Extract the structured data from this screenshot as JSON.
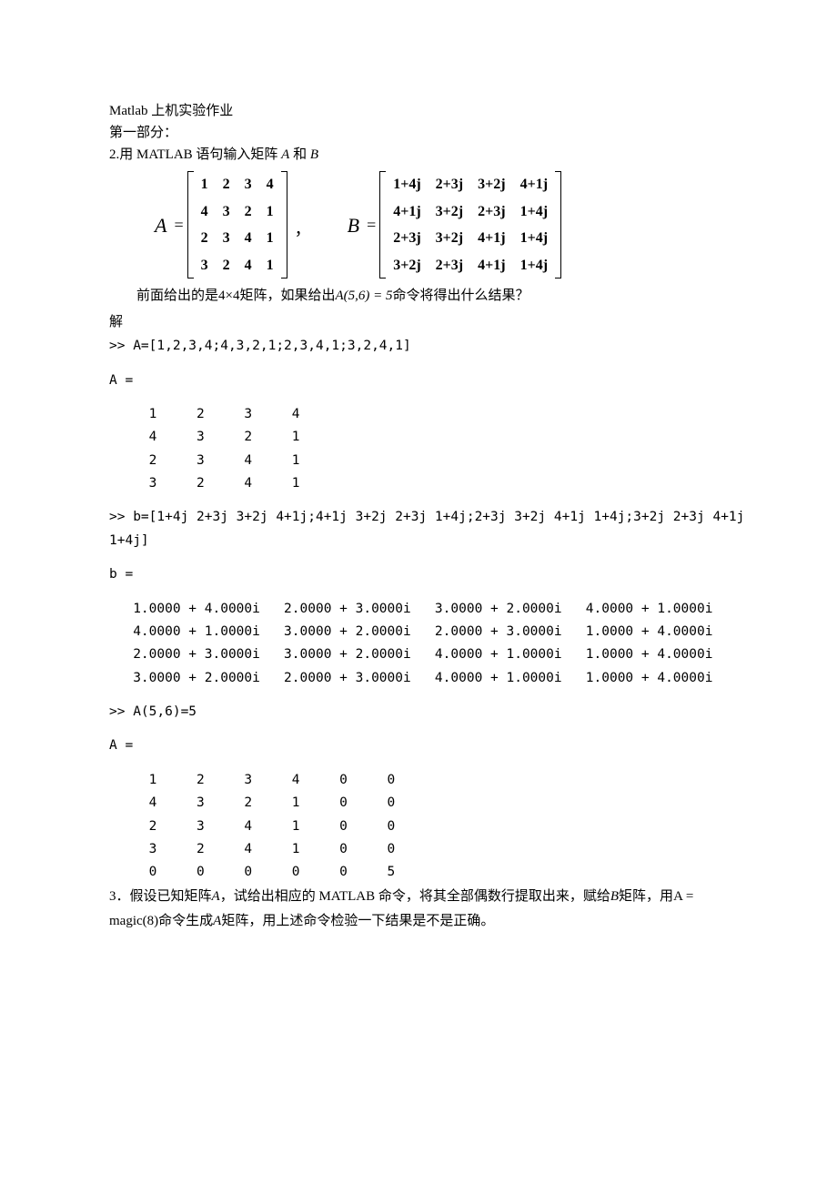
{
  "title": "Matlab 上机实验作业",
  "section": "第一部分：",
  "q2_intro": "2.用 MATLAB 语句输入矩阵",
  "q2_intro_and": "和",
  "A_label": "A",
  "B_label": "B",
  "A_matrix": [
    [
      "1",
      "2",
      "3",
      "4"
    ],
    [
      "4",
      "3",
      "2",
      "1"
    ],
    [
      "2",
      "3",
      "4",
      "1"
    ],
    [
      "3",
      "2",
      "4",
      "1"
    ]
  ],
  "B_matrix": [
    [
      "1+4j",
      "2+3j",
      "3+2j",
      "4+1j"
    ],
    [
      "4+1j",
      "3+2j",
      "2+3j",
      "1+4j"
    ],
    [
      "2+3j",
      "3+2j",
      "4+1j",
      "1+4j"
    ],
    [
      "3+2j",
      "2+3j",
      "4+1j",
      "1+4j"
    ]
  ],
  "q2_followup_a": "前面给出的是",
  "q2_followup_b": "4×4",
  "q2_followup_c": "矩阵，如果给出",
  "q2_followup_d": "A(5,6) = 5",
  "q2_followup_e": "命令将得出什么结果？",
  "solve": "解",
  "code1": ">> A=[1,2,3,4;4,3,2,1;2,3,4,1;3,2,4,1]",
  "out_A_header": "A =",
  "out_A_rows": "     1     2     3     4\n     4     3     2     1\n     2     3     4     1\n     3     2     4     1",
  "code2": ">> b=[1+4j 2+3j 3+2j 4+1j;4+1j 3+2j 2+3j 1+4j;2+3j 3+2j 4+1j 1+4j;3+2j 2+3j 4+1j \n1+4j]",
  "out_b_header": "b =",
  "out_b_rows": "   1.0000 + 4.0000i   2.0000 + 3.0000i   3.0000 + 2.0000i   4.0000 + 1.0000i\n   4.0000 + 1.0000i   3.0000 + 2.0000i   2.0000 + 3.0000i   1.0000 + 4.0000i\n   2.0000 + 3.0000i   3.0000 + 2.0000i   4.0000 + 1.0000i   1.0000 + 4.0000i\n   3.0000 + 2.0000i   2.0000 + 3.0000i   4.0000 + 1.0000i   1.0000 + 4.0000i",
  "code3": ">> A(5,6)=5",
  "out_A2_header": "A =",
  "out_A2_rows": "     1     2     3     4     0     0\n     4     3     2     1     0     0\n     2     3     4     1     0     0\n     3     2     4     1     0     0\n     0     0     0     0     0     5",
  "q3_a": "3．假设已知矩阵",
  "q3_b": "，试给出相应的 MATLAB 命令，将其全部偶数行提取出来，赋给",
  "q3_c": "矩阵，用",
  "q3_d": "A = magic(8)",
  "q3_e": "命令生成",
  "q3_f": "矩阵，用上述命令检验一下结果是不是正确。",
  "A_italic": "A",
  "B_italic": "B"
}
